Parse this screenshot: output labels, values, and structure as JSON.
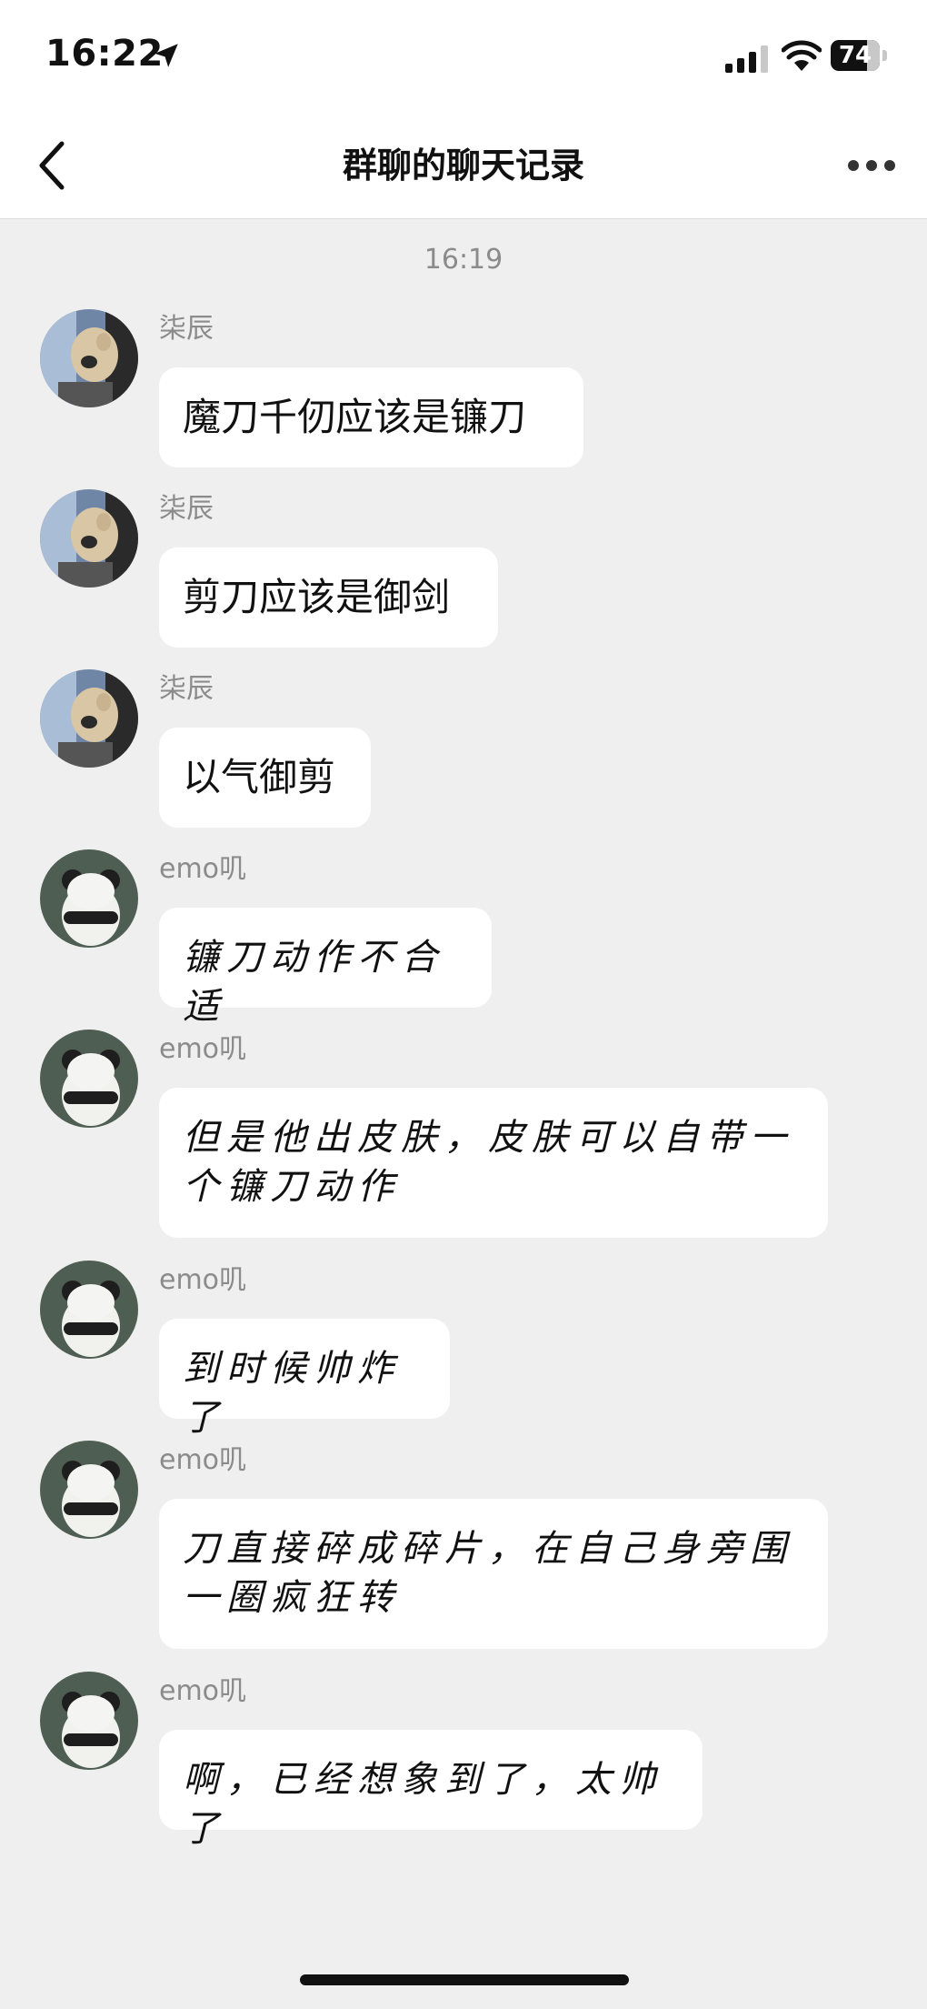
{
  "status_bar": {
    "time": "16:22",
    "battery": "74",
    "battery_level": 0.74
  },
  "nav": {
    "title": "群聊的聊天记录"
  },
  "timestamp": "16:19",
  "messages": [
    {
      "sender": "柒辰",
      "text": "魔刀千仞应该是镰刀"
    },
    {
      "sender": "柒辰",
      "text": "剪刀应该是御剑"
    },
    {
      "sender": "柒辰",
      "text": "以气御剪"
    },
    {
      "sender": "emo叽",
      "text": "镰刀动作不合适"
    },
    {
      "sender": "emo叽",
      "text": "但是他出皮肤，皮肤可以自带一个镰刀动作"
    },
    {
      "sender": "emo叽",
      "text": "到时候帅炸了"
    },
    {
      "sender": "emo叽",
      "text": "刀直接碎成碎片，在自己身旁围一圈疯狂转"
    },
    {
      "sender": "emo叽",
      "text": "啊，已经想象到了，太帅了"
    }
  ],
  "icons": {
    "location": "location-arrow-icon",
    "signal": "cellular-signal-icon",
    "wifi": "wifi-icon",
    "back": "back-chevron-icon",
    "more": "more-dots-icon"
  },
  "colors": {
    "background": "#efefef",
    "bubble": "#ffffff",
    "secondary_text": "#8b8b8b"
  }
}
